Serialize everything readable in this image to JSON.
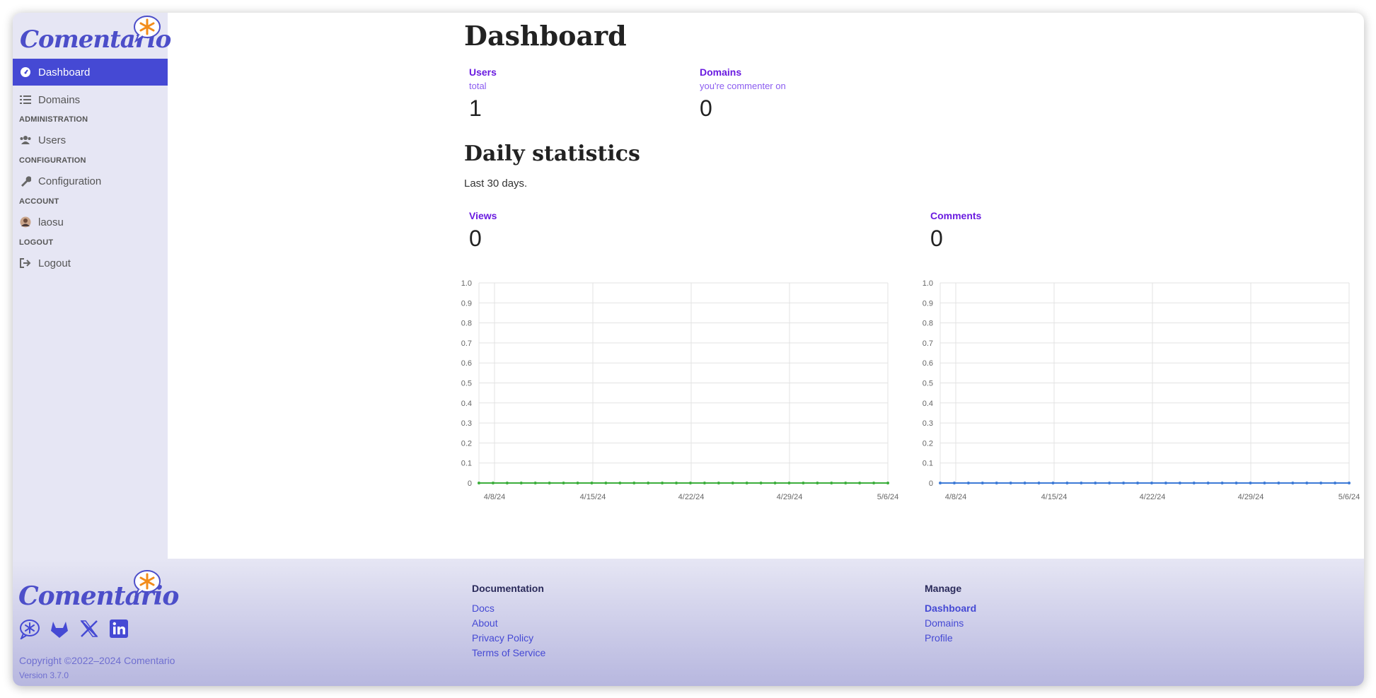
{
  "brand": {
    "name": "Comentario",
    "accent": "#4549d4",
    "asterisk_color": "#f28c1b"
  },
  "sidebar": {
    "items": [
      {
        "label": "Dashboard",
        "icon": "gauge-icon",
        "active": true
      },
      {
        "label": "Domains",
        "icon": "list-icon"
      }
    ],
    "sections": [
      {
        "title": "ADMINISTRATION",
        "items": [
          {
            "label": "Users",
            "icon": "users-icon"
          }
        ]
      },
      {
        "title": "CONFIGURATION",
        "items": [
          {
            "label": "Configuration",
            "icon": "wrench-icon"
          }
        ]
      },
      {
        "title": "ACCOUNT",
        "items": [
          {
            "label": "laosu",
            "icon": "avatar-icon"
          }
        ]
      },
      {
        "title": "LOGOUT",
        "items": [
          {
            "label": "Logout",
            "icon": "logout-icon"
          }
        ]
      }
    ]
  },
  "main": {
    "title": "Dashboard",
    "stats": [
      {
        "label": "Users",
        "sub": "total",
        "value": "1"
      },
      {
        "label": "Domains",
        "sub": "you're commenter on",
        "value": "0"
      }
    ],
    "daily": {
      "title": "Daily statistics",
      "note": "Last 30 days."
    }
  },
  "chart_data": [
    {
      "type": "line",
      "title": "Views",
      "total": "0",
      "color": "#3cae3c",
      "x_ticks": [
        "4/8/24",
        "4/15/24",
        "4/22/24",
        "4/29/24",
        "5/6/24"
      ],
      "y_ticks": [
        "0",
        "0.1",
        "0.2",
        "0.3",
        "0.4",
        "0.5",
        "0.6",
        "0.7",
        "0.8",
        "0.9",
        "1.0"
      ],
      "ylim": [
        0,
        1
      ],
      "points": 30,
      "values": [
        0,
        0,
        0,
        0,
        0,
        0,
        0,
        0,
        0,
        0,
        0,
        0,
        0,
        0,
        0,
        0,
        0,
        0,
        0,
        0,
        0,
        0,
        0,
        0,
        0,
        0,
        0,
        0,
        0,
        0
      ],
      "grid": true
    },
    {
      "type": "line",
      "title": "Comments",
      "total": "0",
      "color": "#3d7ad6",
      "x_ticks": [
        "4/8/24",
        "4/15/24",
        "4/22/24",
        "4/29/24",
        "5/6/24"
      ],
      "y_ticks": [
        "0",
        "0.1",
        "0.2",
        "0.3",
        "0.4",
        "0.5",
        "0.6",
        "0.7",
        "0.8",
        "0.9",
        "1.0"
      ],
      "ylim": [
        0,
        1
      ],
      "points": 30,
      "values": [
        0,
        0,
        0,
        0,
        0,
        0,
        0,
        0,
        0,
        0,
        0,
        0,
        0,
        0,
        0,
        0,
        0,
        0,
        0,
        0,
        0,
        0,
        0,
        0,
        0,
        0,
        0,
        0,
        0,
        0
      ],
      "grid": true
    }
  ],
  "footer": {
    "brand": "Comentario",
    "social": [
      "comentario-icon",
      "gitlab-icon",
      "x-icon",
      "linkedin-icon"
    ],
    "copyright": "Copyright ©2022–2024 Comentario",
    "version": "Version 3.7.0",
    "documentation": {
      "title": "Documentation",
      "links": [
        "Docs",
        "About",
        "Privacy Policy",
        "Terms of Service"
      ]
    },
    "manage": {
      "title": "Manage",
      "links": [
        "Dashboard",
        "Domains",
        "Profile"
      ]
    }
  }
}
